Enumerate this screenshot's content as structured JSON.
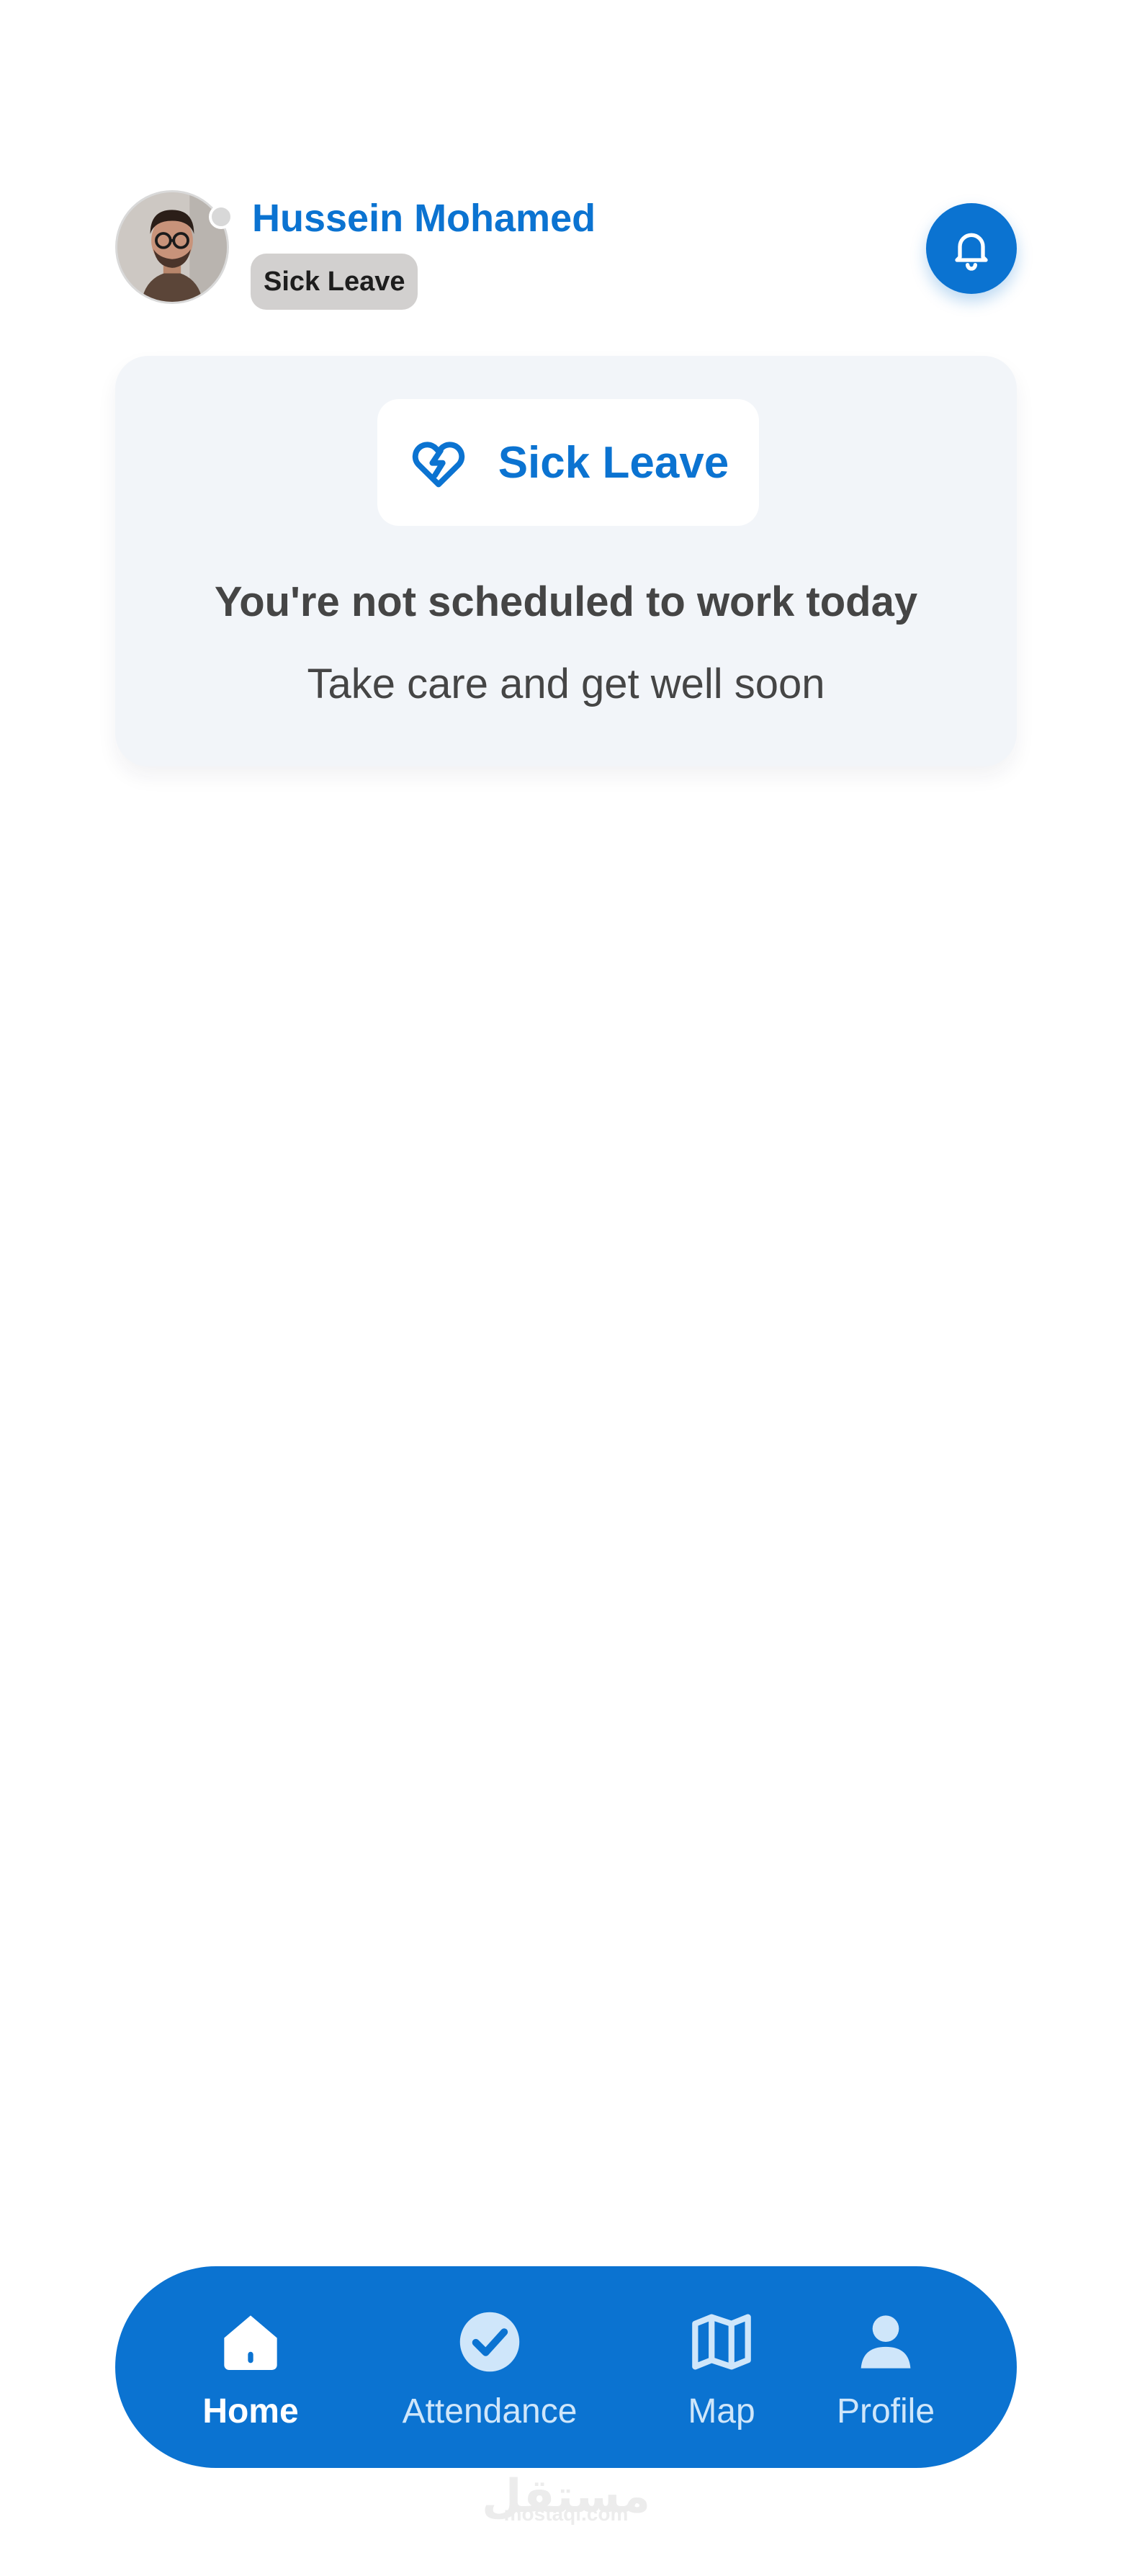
{
  "user": {
    "name": "Hussein Mohamed",
    "status_badge": "Sick Leave"
  },
  "status_card": {
    "pill_label": "Sick Leave",
    "title": "You're not scheduled to work today",
    "subtitle": "Take care and get well soon"
  },
  "nav": {
    "items": [
      {
        "label": "Home",
        "icon": "home-icon",
        "active": true
      },
      {
        "label": "Attendance",
        "icon": "check-circle-icon",
        "active": false
      },
      {
        "label": "Map",
        "icon": "map-icon",
        "active": false
      },
      {
        "label": "Profile",
        "icon": "user-icon",
        "active": false
      }
    ]
  },
  "watermark": {
    "main": "مستقل",
    "sub": "mostaql.com"
  },
  "colors": {
    "primary": "#0b73d1",
    "card_background": "#f2f5f9",
    "badge_background": "#d2d0cf",
    "text_dark": "#454545"
  }
}
